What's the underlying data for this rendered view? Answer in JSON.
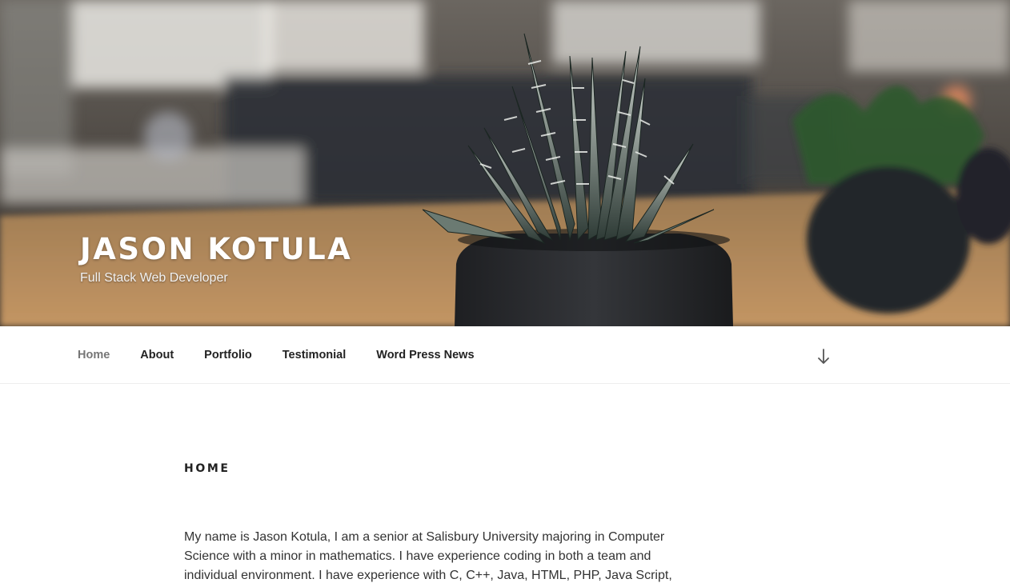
{
  "site": {
    "title": "JASON KOTULA",
    "description": "Full Stack Web Developer"
  },
  "nav": {
    "items": [
      {
        "label": "Home",
        "current": true
      },
      {
        "label": "About",
        "current": false
      },
      {
        "label": "Portfolio",
        "current": false
      },
      {
        "label": "Testimonial",
        "current": false
      },
      {
        "label": "Word Press News",
        "current": false
      }
    ],
    "scroll_icon": "arrow-down-icon"
  },
  "page": {
    "title": "HOME",
    "lines": [
      "My name is Jason Kotula, I am a senior at Salisbury University majoring in Computer",
      "Science with a minor in mathematics. I have experience coding in both a team and",
      "individual environment. I have experience with C, C++, Java, HTML, PHP, Java Script,"
    ]
  },
  "colors": {
    "text": "#222222",
    "nav_current": "#767676",
    "header_text": "#ffffff"
  }
}
